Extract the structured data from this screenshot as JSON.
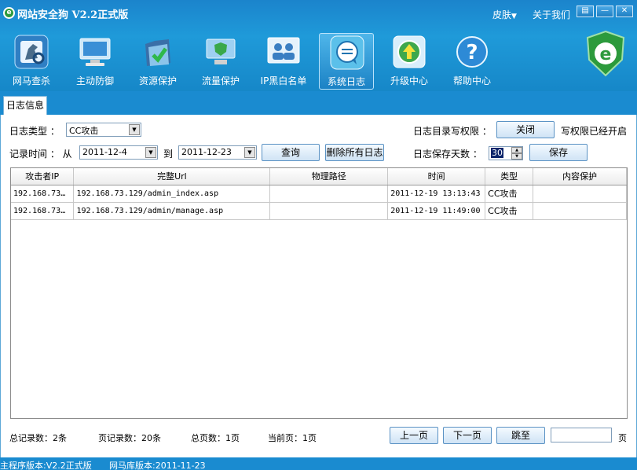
{
  "window": {
    "title": "网站安全狗 V2.2正式版",
    "logo_letter": "e",
    "skin_label": "皮肤",
    "skin_arrow": "▼",
    "about_label": "关于我们",
    "btn_menu": "▤",
    "btn_min": "—",
    "btn_close": "✕"
  },
  "toolbar": [
    {
      "label": "网马查杀",
      "icon": "horse-scan-icon"
    },
    {
      "label": "主动防御",
      "icon": "monitor-shield-icon"
    },
    {
      "label": "资源保护",
      "icon": "folder-check-icon"
    },
    {
      "label": "流量保护",
      "icon": "screen-shield-icon"
    },
    {
      "label": "IP黑白名单",
      "icon": "users-list-icon"
    },
    {
      "label": "系统日志",
      "icon": "chat-log-icon"
    },
    {
      "label": "升级中心",
      "icon": "upgrade-arrow-icon"
    },
    {
      "label": "帮助中心",
      "icon": "help-question-icon"
    }
  ],
  "tab": {
    "label": "日志信息"
  },
  "filters": {
    "log_type_label": "日志类型 ：",
    "log_type_value": "CC攻击",
    "record_time_label": "记录时间 ： 从",
    "date_from": "2011-12-4",
    "to_label": "到",
    "date_to": "2011-12-23",
    "query_button": "查询",
    "delete_all_button": "删除所有日志",
    "write_perm_label": "日志目录写权限 ：",
    "close_button": "关闭",
    "write_perm_status": "写权限已经开启",
    "keep_days_label": "日志保存天数 ：",
    "keep_days_value": "30",
    "save_button": "保存"
  },
  "table": {
    "columns": [
      "攻击者IP",
      "完整Url",
      "物理路径",
      "时间",
      "类型",
      "内容保护"
    ],
    "rows": [
      [
        "192.168.73…",
        "192.168.73.129/admin_index.asp",
        "",
        "2011-12-19 13:13:43",
        "CC攻击",
        ""
      ],
      [
        "192.168.73…",
        "192.168.73.129/admin/manage.asp",
        "",
        "2011-12-19 11:49:00",
        "CC攻击",
        ""
      ]
    ]
  },
  "pager": {
    "total_records": "总记录数：2条",
    "page_records": "页记录数：20条",
    "total_pages": "总页数：1页",
    "current_page": "当前页：1页",
    "prev_button": "上一页",
    "next_button": "下一页",
    "jump_button": "跳至",
    "page_suffix": "页"
  },
  "status": {
    "main_version": "主程序版本:V2.2正式版",
    "db_version": "网马库版本:2011-11-23"
  },
  "colors": {
    "title_blue": "#1f9ad9",
    "accent_green": "#2c9a3c"
  }
}
